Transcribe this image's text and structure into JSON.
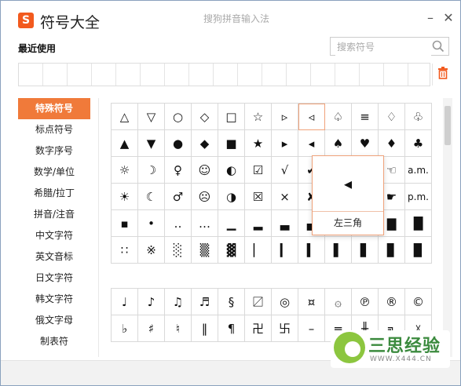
{
  "app": {
    "logo_letter": "S",
    "title": "符号大全",
    "subtitle": "搜狗拼音输入法"
  },
  "window_controls": {
    "minimize": "–",
    "close": "✕"
  },
  "recent": {
    "label": "最近使用",
    "slot_count": 17
  },
  "search": {
    "placeholder": "搜索符号",
    "value": ""
  },
  "sidebar": {
    "items": [
      {
        "label": "特殊符号",
        "active": true
      },
      {
        "label": "标点符号"
      },
      {
        "label": "数字序号"
      },
      {
        "label": "数学/单位"
      },
      {
        "label": "希腊/拉丁"
      },
      {
        "label": "拼音/注音"
      },
      {
        "label": "中文字符"
      },
      {
        "label": "英文音标"
      },
      {
        "label": "日文字符"
      },
      {
        "label": "韩文字符"
      },
      {
        "label": "俄文字母"
      },
      {
        "label": "制表符"
      }
    ]
  },
  "symbols_group1": [
    "△",
    "▽",
    "○",
    "◇",
    "□",
    "☆",
    "▹",
    "◃",
    "♤",
    "≡",
    "♢",
    "♧",
    "▲",
    "▼",
    "●",
    "◆",
    "■",
    "★",
    "▸",
    "◂",
    "♠",
    "♥",
    "♦",
    "♣",
    "☼",
    "☽",
    "♀",
    "☺",
    "◐",
    "☑",
    "√",
    "✔",
    "",
    "",
    "☜",
    "a.m.",
    "☀",
    "☾",
    "♂",
    "☹",
    "◑",
    "☒",
    "×",
    "✘",
    "",
    "",
    "☛",
    "p.m.",
    "▪",
    "•",
    "‥",
    "…",
    "▁",
    "▂",
    "▃",
    "▄",
    "",
    "",
    "▇",
    "█",
    "∷",
    "※",
    "░",
    "▒",
    "▓",
    "▏",
    "▎",
    "▍",
    "▌",
    "▋",
    "▊",
    "▉"
  ],
  "symbols_group2": [
    "♩",
    "♪",
    "♫",
    "♬",
    "§",
    "〼",
    "◎",
    "¤",
    "۞",
    "℗",
    "®",
    "©",
    "♭",
    "♯",
    "♮",
    "‖",
    "¶",
    "卍",
    "卐",
    "–",
    "═",
    "╫",
    "╗",
    "☓"
  ],
  "preview": {
    "glyph": "◂",
    "label": "左三角"
  },
  "watermark": {
    "brand": "三思经验",
    "url": "WWW.X444.CN"
  },
  "colors": {
    "accent": "#f07a3a",
    "logo": "#f25a1e",
    "trash": "#f25a1e"
  },
  "icons": [
    "logo-icon",
    "search-icon",
    "trash-icon",
    "minimize-icon",
    "close-icon"
  ]
}
